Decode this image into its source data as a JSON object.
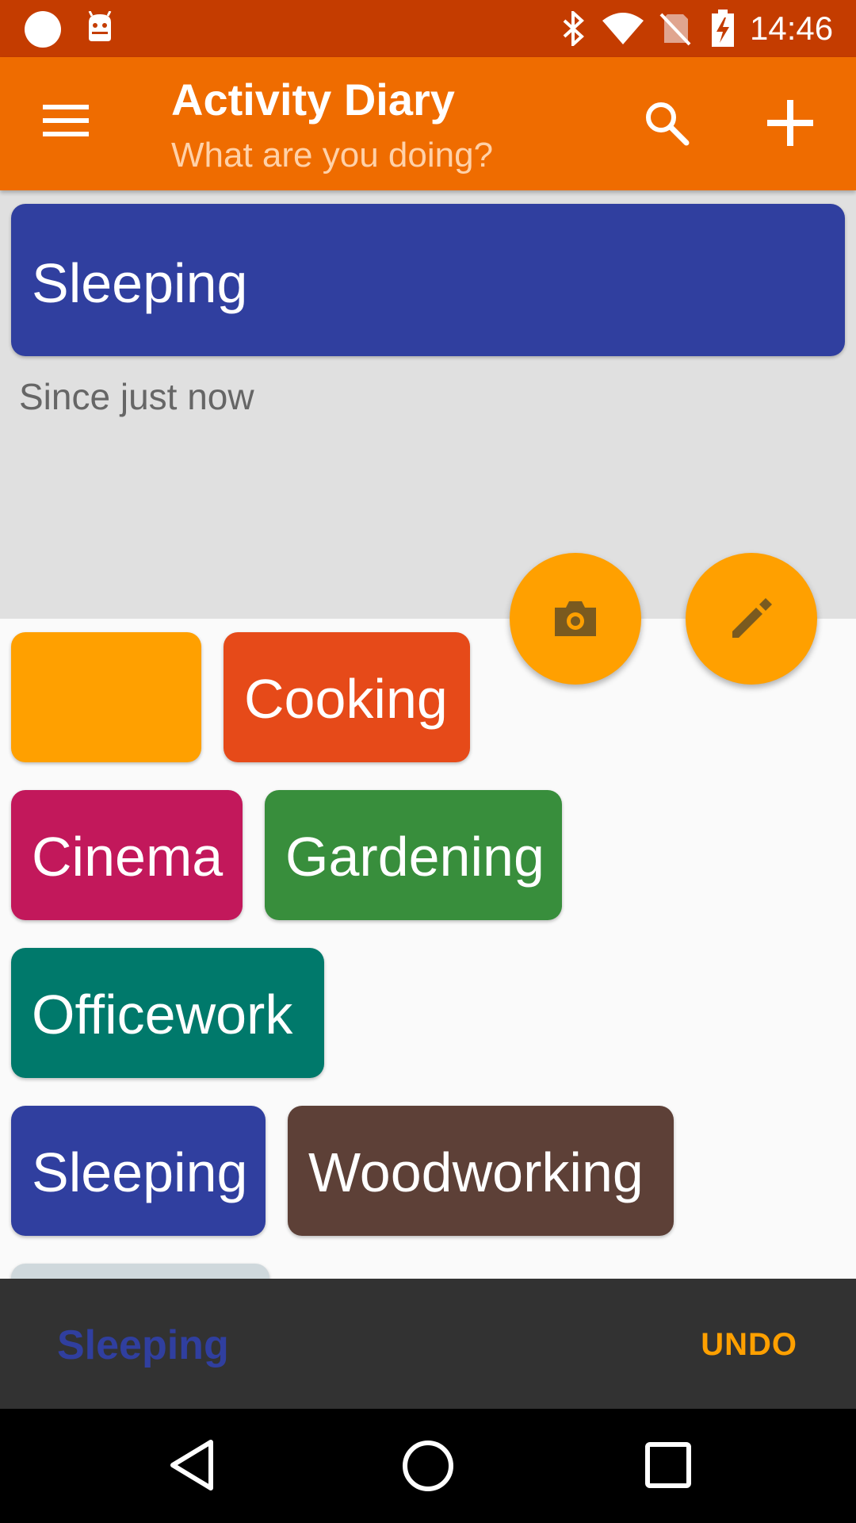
{
  "status_bar": {
    "time": "14:46",
    "icons": [
      "notification-dot-icon",
      "android-icon",
      "bluetooth-icon",
      "wifi-icon",
      "no-sim-icon",
      "battery-charging-icon"
    ],
    "background": "#c43c00"
  },
  "app_bar": {
    "title": "Activity Diary",
    "subtitle": "What are you doing?",
    "icons": [
      "menu-icon",
      "search-icon",
      "add-icon"
    ],
    "background": "#ef6c00"
  },
  "current_activity": {
    "name": "Sleeping",
    "since": "Since just now",
    "color": "#303f9f"
  },
  "fabs": {
    "icons": [
      "camera-icon",
      "edit-icon"
    ],
    "color": "#ffa000"
  },
  "activities": [
    {
      "label": "",
      "color": "#ffa000"
    },
    {
      "label": "Cooking",
      "color": "#e64a19"
    },
    {
      "label": "Cinema",
      "color": "#c2185b"
    },
    {
      "label": "Gardening",
      "color": "#388e3c"
    },
    {
      "label": "Officework",
      "color": "#00796b"
    },
    {
      "label": "Sleeping",
      "color": "#303f9f"
    },
    {
      "label": "Woodworking",
      "color": "#5d4037"
    },
    {
      "label": "",
      "color": "#cfd8dc"
    }
  ],
  "snackbar": {
    "text": "Sleeping",
    "text_color": "#303f9f",
    "action": "UNDO",
    "action_color": "#ffa000"
  },
  "nav_bar": {
    "icons": [
      "back-icon",
      "home-icon",
      "recents-icon"
    ]
  }
}
